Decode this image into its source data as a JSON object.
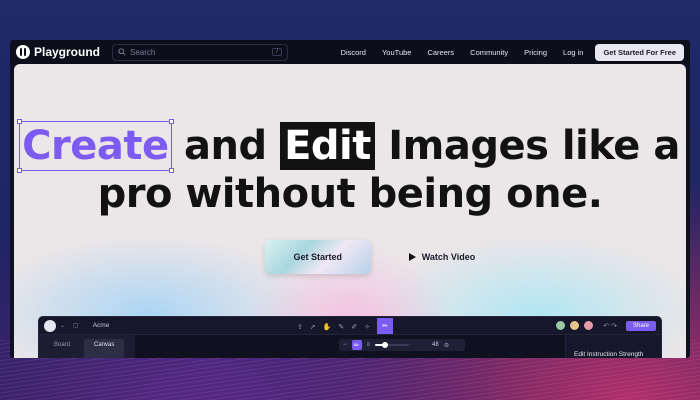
{
  "navbar": {
    "brand": "Playground",
    "search_placeholder": "Search",
    "search_shortcut": "/",
    "links": [
      "Discord",
      "YouTube",
      "Careers",
      "Community",
      "Pricing",
      "Log in"
    ],
    "cta_label": "Get Started For Free"
  },
  "hero": {
    "headline_word1": "Create",
    "headline_mid1": " and ",
    "headline_word2": "Edit",
    "headline_mid2": " Images like a",
    "headline_line2": "pro without being one.",
    "primary_button": "Get Started",
    "secondary_button": "Watch Video"
  },
  "editor": {
    "project_name": "Acme",
    "left_tabs": [
      "Board",
      "Canvas"
    ],
    "active_tab": "Canvas",
    "slider_value": "48",
    "slider_level": 0.3,
    "panel_title": "Edit Instruction Strength",
    "share_label": "Share",
    "avatar_colors": [
      "#9bc7a6",
      "#e8c48a",
      "#e59aa8"
    ],
    "accent": "#7b5cf0"
  }
}
